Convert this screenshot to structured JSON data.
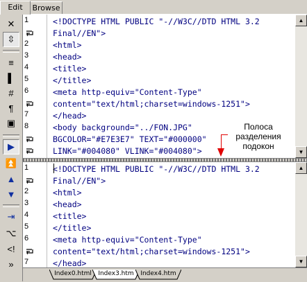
{
  "tabs": {
    "edit": "Edit",
    "browse": "Browse"
  },
  "toolbar": {
    "buttons": [
      {
        "name": "close-icon",
        "glyph": "✕"
      },
      {
        "name": "split-vertical-icon",
        "glyph": "⇳"
      },
      {
        "name": "word-wrap-icon",
        "glyph": "≡"
      },
      {
        "name": "gutter-toggle-icon",
        "glyph": "▌"
      },
      {
        "name": "line-numbers-icon",
        "glyph": "#"
      },
      {
        "name": "paragraph-icon",
        "glyph": "¶"
      },
      {
        "name": "screen-icon",
        "glyph": "▣"
      },
      {
        "name": "play-icon",
        "glyph": "▶"
      },
      {
        "name": "go-top-icon",
        "glyph": "⏫"
      },
      {
        "name": "arrow-up-icon",
        "glyph": "▲"
      },
      {
        "name": "arrow-down-icon",
        "glyph": "▼"
      },
      {
        "name": "indent-icon",
        "glyph": "⇥"
      },
      {
        "name": "tree-icon",
        "glyph": "⌥"
      },
      {
        "name": "tag-icon",
        "glyph": "<!"
      },
      {
        "name": "more-icon",
        "glyph": "»"
      }
    ]
  },
  "editor_top": {
    "gutter": [
      {
        "num": "1",
        "wrap": false
      },
      {
        "num": "",
        "wrap": true
      },
      {
        "num": "2",
        "wrap": false
      },
      {
        "num": "3",
        "wrap": false
      },
      {
        "num": "4",
        "wrap": false
      },
      {
        "num": "5",
        "wrap": false
      },
      {
        "num": "6",
        "wrap": false
      },
      {
        "num": "",
        "wrap": true
      },
      {
        "num": "7",
        "wrap": false
      },
      {
        "num": "8",
        "wrap": false
      },
      {
        "num": "",
        "wrap": true
      },
      {
        "num": "",
        "wrap": true
      }
    ],
    "lines": [
      "<!DOCTYPE HTML PUBLIC \"-//W3C//DTD HTML 3.2",
      "Final//EN\">",
      "<html>",
      "<head>",
      "<title>",
      "</title>",
      "<meta http-equiv=\"Content-Type\"",
      "content=\"text/html;charset=windows-1251\">",
      "</head>",
      "<body background=\"../FON.JPG\"",
      "BGCOLOR=\"#E7E3E7\" TEXT=\"#000000\"",
      "LINK=\"#004080\" VLINK=\"#004080\">"
    ]
  },
  "editor_bottom": {
    "gutter": [
      {
        "num": "1",
        "wrap": false
      },
      {
        "num": "",
        "wrap": true
      },
      {
        "num": "2",
        "wrap": false
      },
      {
        "num": "3",
        "wrap": false
      },
      {
        "num": "4",
        "wrap": false
      },
      {
        "num": "5",
        "wrap": false
      },
      {
        "num": "6",
        "wrap": false
      },
      {
        "num": "",
        "wrap": true
      },
      {
        "num": "7",
        "wrap": false
      }
    ],
    "lines": [
      "<!DOCTYPE HTML PUBLIC \"-//W3C//DTD HTML 3.2",
      "Final//EN\">",
      "<html>",
      "<head>",
      "<title>",
      "</title>",
      "<meta http-equiv=\"Content-Type\"",
      "content=\"text/html;charset=windows-1251\">",
      "</head>"
    ]
  },
  "annotation": {
    "line1": "Полоса",
    "line2": "разделения",
    "line3": "подокон",
    "color": "#e00000"
  },
  "file_tabs": [
    "Index0.html",
    "Index3.htm",
    "Index4.htm"
  ],
  "colors": {
    "code": "#000080",
    "background": "#d4d0c8"
  }
}
